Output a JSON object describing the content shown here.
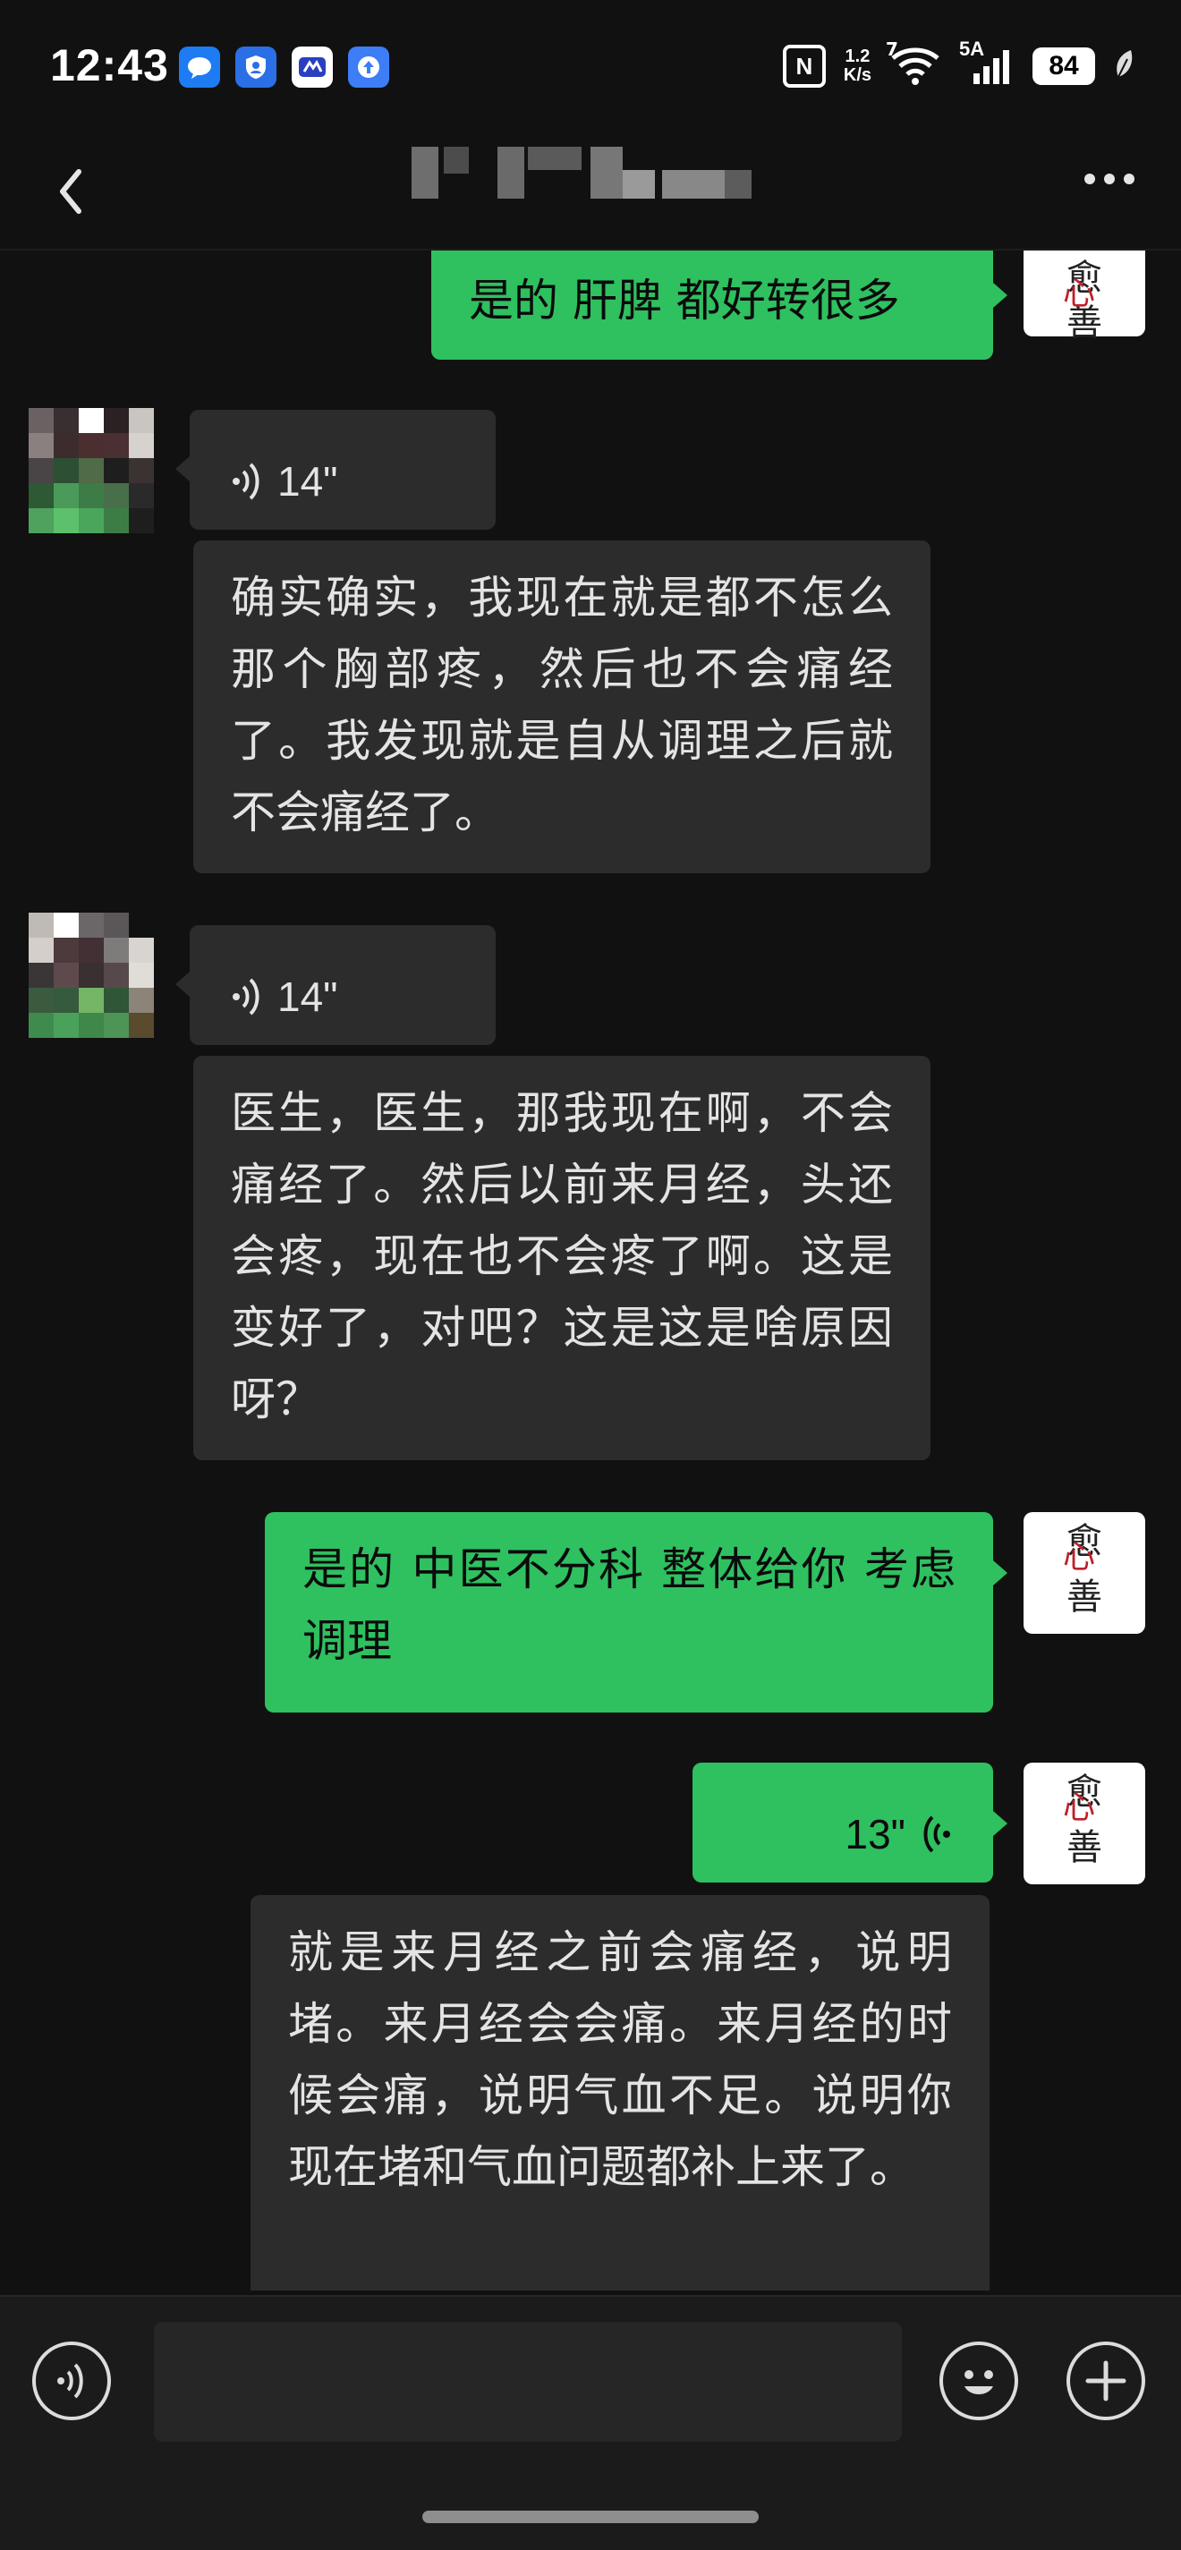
{
  "status_bar": {
    "time": "12:43",
    "network_speed_value": "1.2",
    "network_speed_unit": "K/s",
    "wifi_badge": "7",
    "signal_label": "5A",
    "battery": "84"
  },
  "header": {
    "contact_name_blurred": true
  },
  "messages": [
    {
      "side": "out",
      "type": "text",
      "text": "是的 肝脾 都好转很多"
    },
    {
      "side": "in",
      "type": "voice",
      "duration": "14\""
    },
    {
      "side": "in",
      "type": "transcript",
      "text": "确实确实，我现在就是都不怎么那个胸部疼，然后也不会痛经了。我发现就是自从调理之后就不会痛经了。"
    },
    {
      "side": "in",
      "type": "voice",
      "duration": "14\""
    },
    {
      "side": "in",
      "type": "transcript",
      "text": "医生，医生，那我现在啊，不会痛经了。然后以前来月经，头还会疼，现在也不会疼了啊。这是变好了，对吧？这是这是啥原因呀？"
    },
    {
      "side": "out",
      "type": "text",
      "text": "是的 中医不分科 整体给你 考虑调理"
    },
    {
      "side": "out",
      "type": "voice",
      "duration": "13\""
    },
    {
      "side": "out",
      "type": "transcript",
      "text": "就是来月经之前会痛经，说明堵。来月经会会痛。来月经的时候会痛，说明气血不足。说明你现在堵和气血问题都补上来了。"
    }
  ],
  "my_avatar": {
    "logo_top": "愈",
    "logo_bottom": "善",
    "logo_mark": "心"
  },
  "input_bar": {
    "text_value": ""
  },
  "colors": {
    "background": "#111111",
    "outgoing_bubble": "#2fc060",
    "incoming_bubble": "#2c2c2c",
    "input_bar": "#1b1b1b"
  }
}
